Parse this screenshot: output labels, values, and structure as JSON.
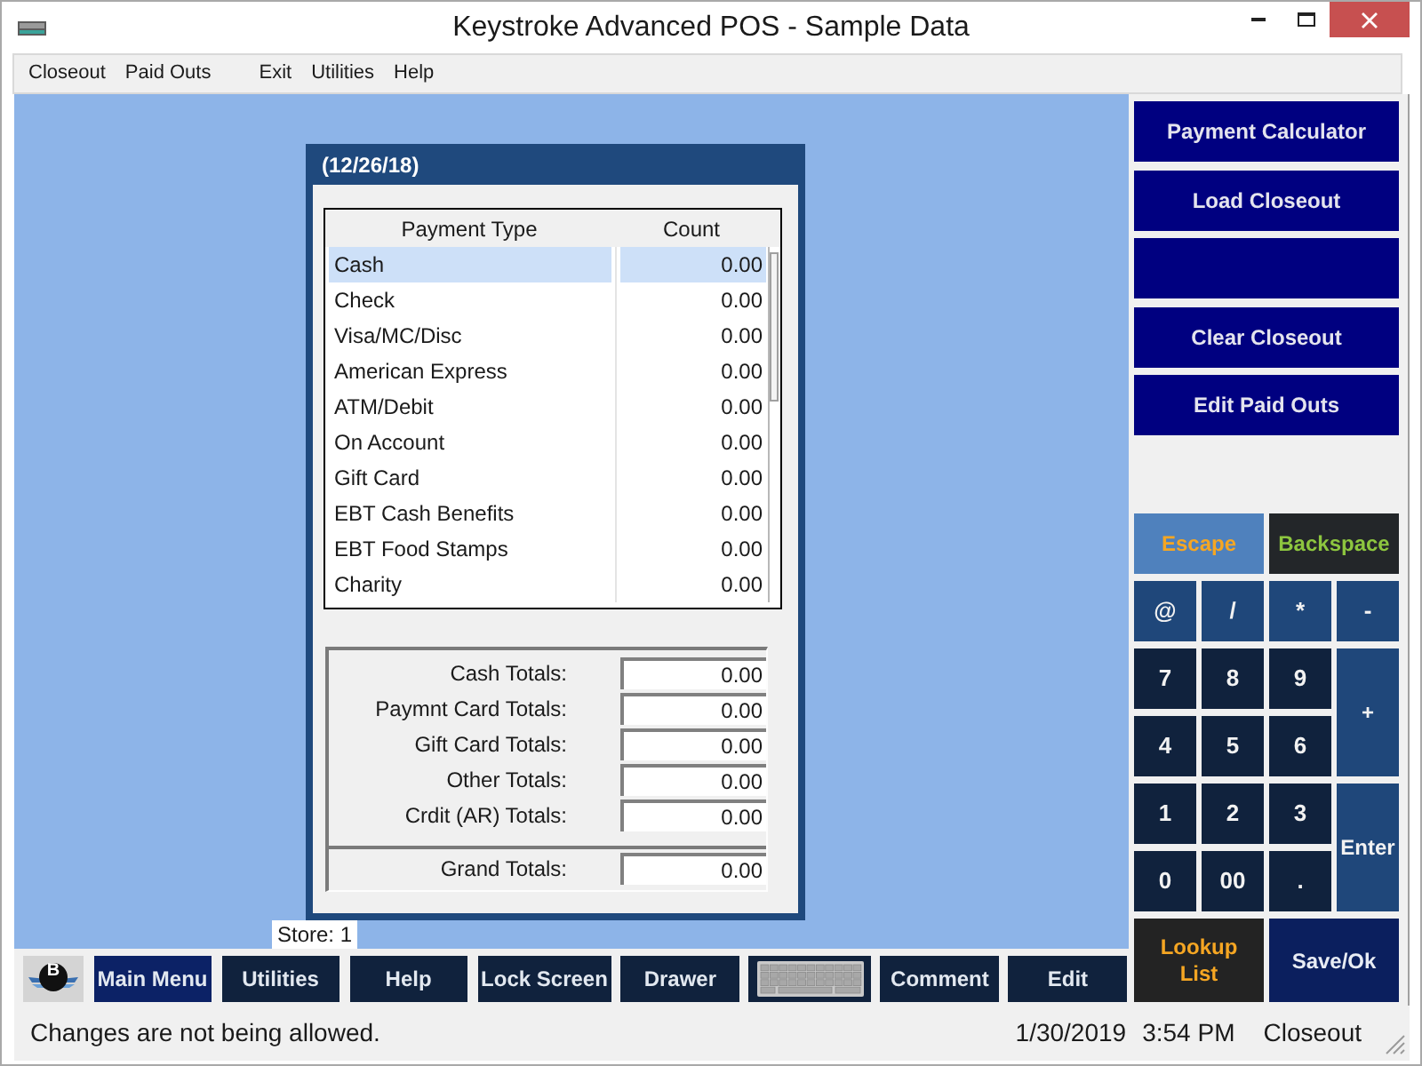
{
  "window": {
    "title": "Keystroke Advanced POS - Sample Data"
  },
  "menu_groups": [
    {
      "items": [
        {
          "label": "Closeout"
        },
        {
          "label": "Paid Outs"
        }
      ]
    },
    {
      "items": [
        {
          "label": "Exit"
        },
        {
          "label": "Utilities"
        },
        {
          "label": "Help"
        }
      ]
    }
  ],
  "dialog": {
    "title": "(12/26/18)",
    "table": {
      "columns": [
        "Payment Type",
        "Count"
      ],
      "rows": [
        {
          "payment_type": "Cash",
          "count": "0.00",
          "selected": true
        },
        {
          "payment_type": "Check",
          "count": "0.00",
          "selected": false
        },
        {
          "payment_type": "Visa/MC/Disc",
          "count": "0.00",
          "selected": false
        },
        {
          "payment_type": "American Express",
          "count": "0.00",
          "selected": false
        },
        {
          "payment_type": "ATM/Debit",
          "count": "0.00",
          "selected": false
        },
        {
          "payment_type": "On Account",
          "count": "0.00",
          "selected": false
        },
        {
          "payment_type": "Gift Card",
          "count": "0.00",
          "selected": false
        },
        {
          "payment_type": "EBT Cash Benefits",
          "count": "0.00",
          "selected": false
        },
        {
          "payment_type": "EBT Food Stamps",
          "count": "0.00",
          "selected": false
        },
        {
          "payment_type": "Charity",
          "count": "0.00",
          "selected": false
        }
      ]
    },
    "totals": [
      {
        "label": "Cash Totals:",
        "value": "0.00"
      },
      {
        "label": "Paymnt Card Totals:",
        "value": "0.00"
      },
      {
        "label": "Gift Card Totals:",
        "value": "0.00"
      },
      {
        "label": "Other Totals:",
        "value": "0.00"
      },
      {
        "label": "Crdit (AR) Totals:",
        "value": "0.00"
      }
    ],
    "grand_total": {
      "label": "Grand Totals:",
      "value": "0.00"
    }
  },
  "store_label": "Store: 1",
  "toolbar": [
    {
      "kind": "logo",
      "label": "B"
    },
    {
      "kind": "primary",
      "label": "Main Menu"
    },
    {
      "kind": "button",
      "label": "Utilities"
    },
    {
      "kind": "button",
      "label": "Help"
    },
    {
      "kind": "button",
      "label": "Lock Screen"
    },
    {
      "kind": "button",
      "label": "Drawer"
    },
    {
      "kind": "keyboard"
    },
    {
      "kind": "button",
      "label": "Comment"
    },
    {
      "kind": "button",
      "label": "Edit"
    }
  ],
  "side_buttons": [
    {
      "kind": "action",
      "label": "Payment Calculator"
    },
    {
      "kind": "action",
      "label": "Load Closeout"
    },
    {
      "kind": "blank"
    },
    {
      "kind": "action",
      "label": "Clear Closeout"
    },
    {
      "kind": "action",
      "label": "Edit Paid Outs"
    }
  ],
  "keypad": [
    {
      "kind": "escape",
      "label": "Escape"
    },
    {
      "kind": "backspace",
      "label": "Backspace"
    },
    {
      "kind": "operator",
      "label": "@"
    },
    {
      "kind": "operator",
      "label": "/"
    },
    {
      "kind": "operator",
      "label": "*"
    },
    {
      "kind": "operator",
      "label": "-"
    },
    {
      "kind": "digit",
      "label": "7"
    },
    {
      "kind": "digit",
      "label": "8"
    },
    {
      "kind": "digit",
      "label": "9"
    },
    {
      "kind": "tall",
      "label": "+"
    },
    {
      "kind": "digit",
      "label": "4"
    },
    {
      "kind": "digit",
      "label": "5"
    },
    {
      "kind": "digit",
      "label": "6"
    },
    {
      "kind": "digit",
      "label": "1"
    },
    {
      "kind": "digit",
      "label": "2"
    },
    {
      "kind": "digit",
      "label": "3"
    },
    {
      "kind": "tall",
      "label": "Enter"
    },
    {
      "kind": "digit",
      "label": "0"
    },
    {
      "kind": "digit",
      "label": "00"
    },
    {
      "kind": "digit",
      "label": "."
    },
    {
      "kind": "lookup",
      "label": "Lookup List"
    },
    {
      "kind": "save",
      "label": "Save/Ok"
    }
  ],
  "status_bar": {
    "message": "Changes are not being allowed.",
    "date": "1/30/2019",
    "time": "3:54 PM",
    "mode": "Closeout"
  }
}
